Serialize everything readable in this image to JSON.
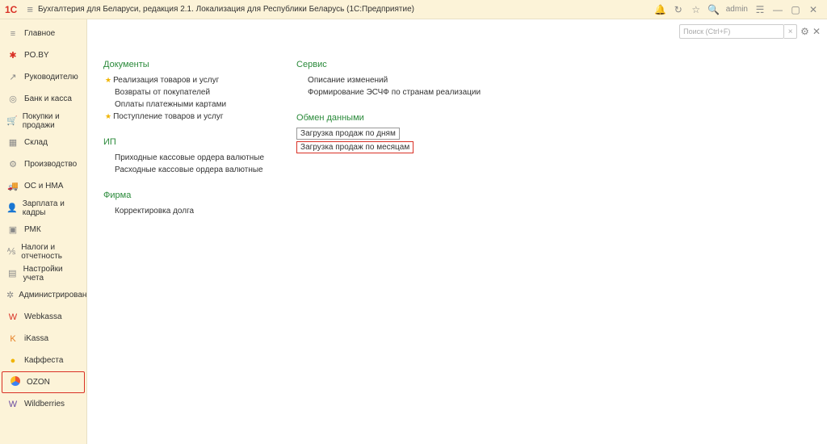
{
  "titlebar": {
    "logo": "1С",
    "title": "Бухгалтерия для Беларуси, редакция 2.1. Локализация для Республики Беларусь  (1С:Предприятие)",
    "username": "admin"
  },
  "search": {
    "placeholder": "Поиск (Ctrl+F)"
  },
  "sidebar": [
    {
      "icon": "≡",
      "label": "Главное",
      "cls": ""
    },
    {
      "icon": "✱",
      "label": "PO.BY",
      "cls": "red"
    },
    {
      "icon": "↗",
      "label": "Руководителю",
      "cls": ""
    },
    {
      "icon": "◎",
      "label": "Банк и касса",
      "cls": ""
    },
    {
      "icon": "🛒",
      "label": "Покупки и продажи",
      "cls": ""
    },
    {
      "icon": "▦",
      "label": "Склад",
      "cls": ""
    },
    {
      "icon": "⚙",
      "label": "Производство",
      "cls": ""
    },
    {
      "icon": "🚚",
      "label": "ОС и НМА",
      "cls": ""
    },
    {
      "icon": "👤",
      "label": "Зарплата и кадры",
      "cls": ""
    },
    {
      "icon": "▣",
      "label": "РМК",
      "cls": ""
    },
    {
      "icon": "⅍",
      "label": "Налоги и отчетность",
      "cls": ""
    },
    {
      "icon": "▤",
      "label": "Настройки учета",
      "cls": ""
    },
    {
      "icon": "✲",
      "label": "Администрирование",
      "cls": ""
    },
    {
      "icon": "W",
      "label": "Webkassa",
      "cls": "red"
    },
    {
      "icon": "K",
      "label": "iKassa",
      "cls": "orange"
    },
    {
      "icon": "●",
      "label": "Каффеста",
      "cls": "yellow"
    },
    {
      "icon": "OZON",
      "label": "OZON",
      "cls": "ozon",
      "selected": true
    },
    {
      "icon": "W",
      "label": "Wildberries",
      "cls": "purple"
    }
  ],
  "content": {
    "col1": {
      "documents_h": "Документы",
      "documents": [
        {
          "label": "Реализация товаров и услуг",
          "star": true
        },
        {
          "label": "Возвраты от покупателей",
          "star": false
        },
        {
          "label": "Оплаты платежными картами",
          "star": false
        },
        {
          "label": "Поступление товаров и услуг",
          "star": true
        }
      ],
      "ip_h": "ИП",
      "ip": [
        {
          "label": "Приходные кассовые ордера валютные"
        },
        {
          "label": "Расходные кассовые ордера валютные"
        }
      ],
      "firma_h": "Фирма",
      "firma": [
        {
          "label": "Корректировка долга"
        }
      ]
    },
    "col2": {
      "service_h": "Сервис",
      "service": [
        {
          "label": "Описание изменений"
        },
        {
          "label": "Формирование ЭСЧФ по странам реализации"
        }
      ],
      "exchange_h": "Обмен данными",
      "exchange": [
        {
          "label": "Загрузка продаж по дням",
          "box": "plain"
        },
        {
          "label": "Загрузка продаж по месяцам",
          "box": "red"
        }
      ]
    }
  }
}
